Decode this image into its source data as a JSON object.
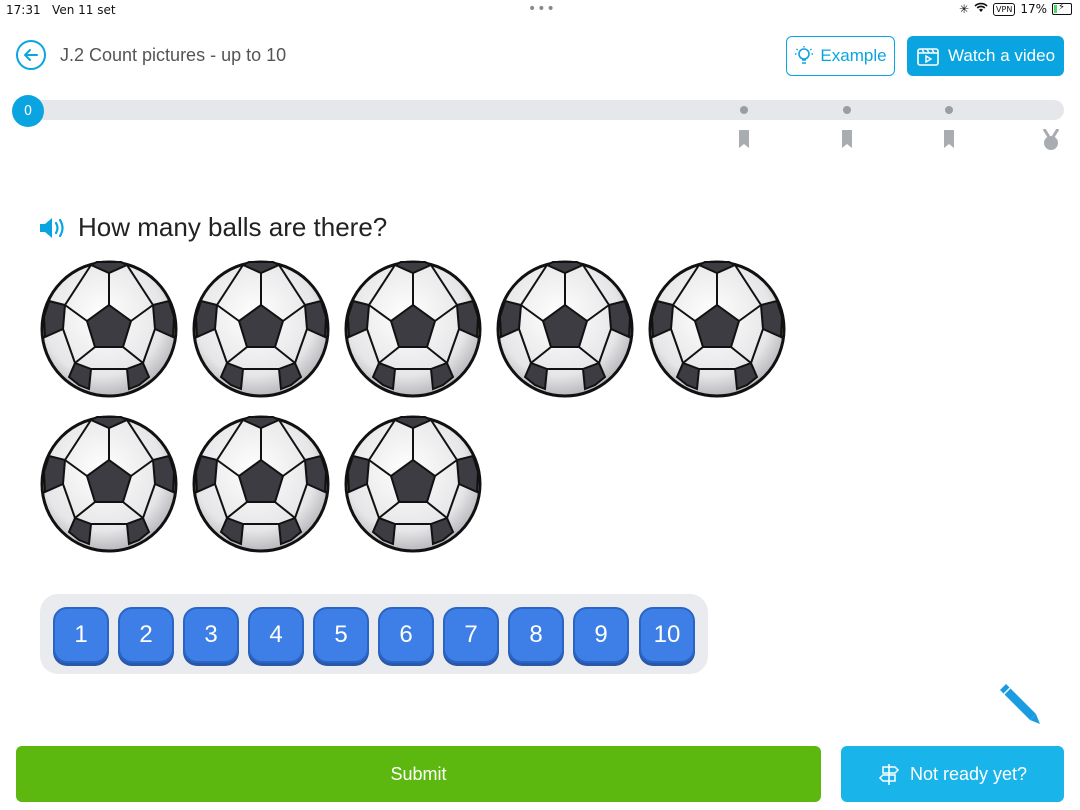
{
  "status_bar": {
    "time": "17:31",
    "date": "Ven 11 set",
    "vpn": "VPN",
    "battery": "17%"
  },
  "header": {
    "title": "J.2 Count pictures - up to 10",
    "example_label": "Example",
    "video_label": "Watch a video"
  },
  "progress": {
    "score": "0",
    "milestones": 3
  },
  "question": {
    "text": "How many balls are there?",
    "ball_count": 8
  },
  "answer_pad": {
    "options": [
      "1",
      "2",
      "3",
      "4",
      "5",
      "6",
      "7",
      "8",
      "9",
      "10"
    ]
  },
  "footer": {
    "submit_label": "Submit",
    "not_ready_label": "Not ready yet?"
  },
  "colors": {
    "accent": "#0aa5e1",
    "submit": "#5cb70f",
    "number_button": "#3d7fe6"
  }
}
